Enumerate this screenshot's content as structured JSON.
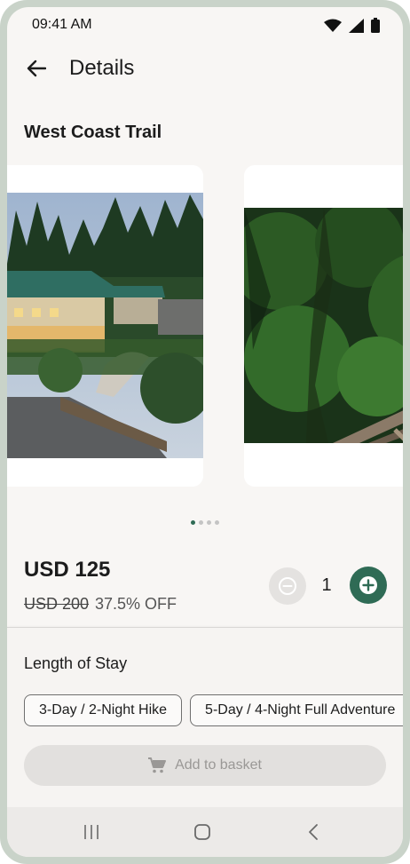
{
  "status_bar": {
    "time": "09:41 AM",
    "icons": [
      "wifi-icon",
      "signal-icon",
      "battery-icon"
    ]
  },
  "app_bar": {
    "title": "Details",
    "back_icon": "arrow-back-icon"
  },
  "product": {
    "title": "West Coast Trail",
    "images": [
      {
        "subject": "lodge-among-forest-photo"
      },
      {
        "subject": "forest-boardwalk-photo"
      }
    ],
    "carousel_dots": 4,
    "active_dot": 0,
    "price": "USD 125",
    "original_price": "USD 200",
    "discount": "37.5% OFF",
    "quantity": "1"
  },
  "stay": {
    "label": "Length of Stay",
    "options": [
      {
        "label": "3-Day / 2-Night Hike"
      },
      {
        "label": "5-Day / 4-Night Full Adventure"
      }
    ]
  },
  "basket": {
    "label": "Add to basket",
    "icon": "cart-icon"
  },
  "colors": {
    "accent": "#2f6b55",
    "background": "#f8f6f4",
    "frame": "#c9d3c9"
  }
}
